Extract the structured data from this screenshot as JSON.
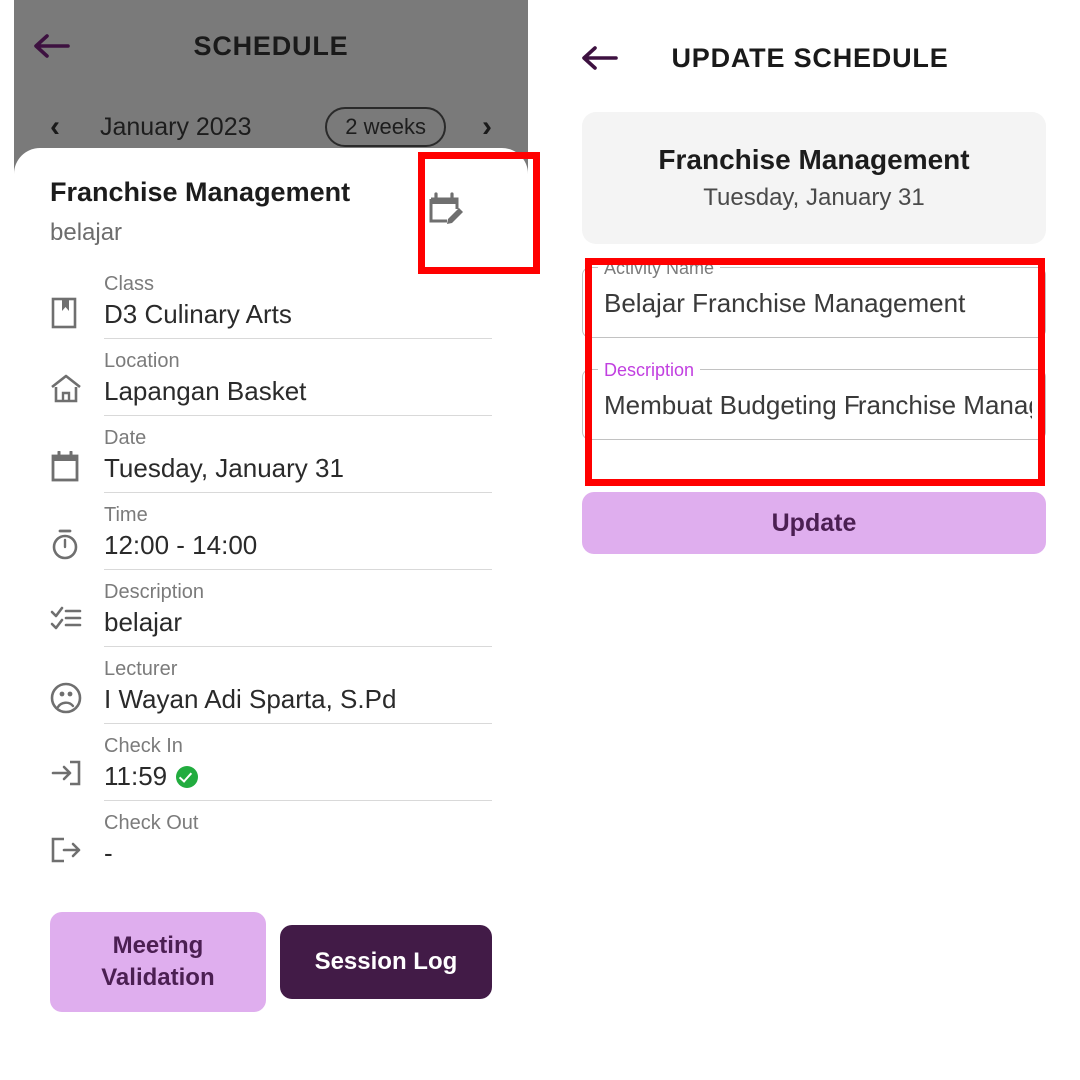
{
  "left_screen": {
    "appbar": {
      "title": "SCHEDULE",
      "back_icon": "arrow-left-icon"
    },
    "month_nav": {
      "prev_icon": "chevron-left-icon",
      "next_icon": "chevron-right-icon",
      "month_label": "January 2023",
      "range_chip": "2 weeks"
    },
    "sheet": {
      "title": "Franchise Management",
      "subtitle": "belajar",
      "edit_icon": "calendar-edit-icon",
      "details": [
        {
          "icon": "book-icon",
          "label": "Class",
          "value": "D3 Culinary Arts"
        },
        {
          "icon": "home-icon",
          "label": "Location",
          "value": "Lapangan Basket"
        },
        {
          "icon": "calendar-icon",
          "label": "Date",
          "value": "Tuesday, January 31"
        },
        {
          "icon": "stopwatch-icon",
          "label": "Time",
          "value": "12:00 - 14:00"
        },
        {
          "icon": "checklist-icon",
          "label": "Description",
          "value": "belajar"
        },
        {
          "icon": "lecturer-icon",
          "label": "Lecturer",
          "value": "I Wayan Adi Sparta, S.Pd"
        },
        {
          "icon": "check-in-icon",
          "label": "Check In",
          "value": "11:59",
          "badge": "verified-check"
        },
        {
          "icon": "check-out-icon",
          "label": "Check Out",
          "value": "-"
        }
      ],
      "actions": {
        "meeting_validation": "Meeting Validation",
        "session_log": "Session Log"
      }
    }
  },
  "right_screen": {
    "appbar": {
      "title": "UPDATE SCHEDULE",
      "back_icon": "arrow-left-icon"
    },
    "summary": {
      "title": "Franchise Management",
      "date": "Tuesday, January 31"
    },
    "form": {
      "fields": [
        {
          "label": "Activity Name",
          "value": "Belajar Franchise Management",
          "focused": false
        },
        {
          "label": "Description",
          "value_before_caret": "Membuat Budgeting F",
          "value_after_caret": "ranchise Manageme",
          "focused": true
        }
      ],
      "submit_label": "Update"
    }
  },
  "colors": {
    "accent_purple": "#421B47",
    "light_purple": "#DFAEEE",
    "focus_magenta": "#C13FE0",
    "annotation_red": "#FF0000",
    "scrim_grey": "#7A7A7A",
    "card_grey": "#F4F4F4",
    "success_green": "#22AC3F"
  },
  "annotations": [
    {
      "name": "edit-schedule-icon-highlight"
    },
    {
      "name": "form-fields-highlight"
    }
  ]
}
